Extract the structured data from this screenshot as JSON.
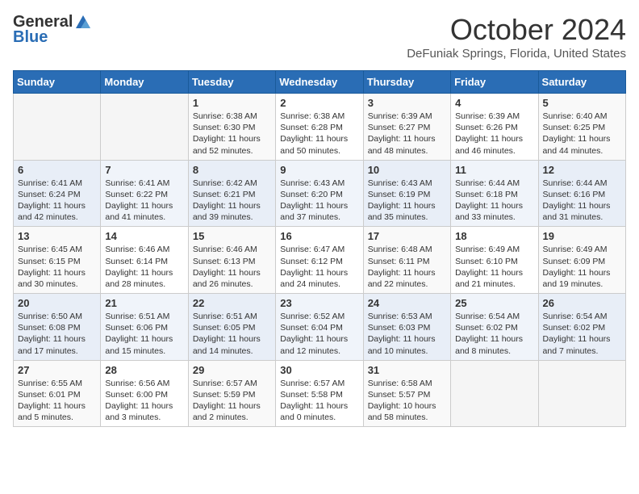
{
  "header": {
    "logo_general": "General",
    "logo_blue": "Blue",
    "month": "October 2024",
    "location": "DeFuniak Springs, Florida, United States"
  },
  "weekdays": [
    "Sunday",
    "Monday",
    "Tuesday",
    "Wednesday",
    "Thursday",
    "Friday",
    "Saturday"
  ],
  "weeks": [
    [
      {
        "day": "",
        "detail": ""
      },
      {
        "day": "",
        "detail": ""
      },
      {
        "day": "1",
        "detail": "Sunrise: 6:38 AM\nSunset: 6:30 PM\nDaylight: 11 hours\nand 52 minutes."
      },
      {
        "day": "2",
        "detail": "Sunrise: 6:38 AM\nSunset: 6:28 PM\nDaylight: 11 hours\nand 50 minutes."
      },
      {
        "day": "3",
        "detail": "Sunrise: 6:39 AM\nSunset: 6:27 PM\nDaylight: 11 hours\nand 48 minutes."
      },
      {
        "day": "4",
        "detail": "Sunrise: 6:39 AM\nSunset: 6:26 PM\nDaylight: 11 hours\nand 46 minutes."
      },
      {
        "day": "5",
        "detail": "Sunrise: 6:40 AM\nSunset: 6:25 PM\nDaylight: 11 hours\nand 44 minutes."
      }
    ],
    [
      {
        "day": "6",
        "detail": "Sunrise: 6:41 AM\nSunset: 6:24 PM\nDaylight: 11 hours\nand 42 minutes."
      },
      {
        "day": "7",
        "detail": "Sunrise: 6:41 AM\nSunset: 6:22 PM\nDaylight: 11 hours\nand 41 minutes."
      },
      {
        "day": "8",
        "detail": "Sunrise: 6:42 AM\nSunset: 6:21 PM\nDaylight: 11 hours\nand 39 minutes."
      },
      {
        "day": "9",
        "detail": "Sunrise: 6:43 AM\nSunset: 6:20 PM\nDaylight: 11 hours\nand 37 minutes."
      },
      {
        "day": "10",
        "detail": "Sunrise: 6:43 AM\nSunset: 6:19 PM\nDaylight: 11 hours\nand 35 minutes."
      },
      {
        "day": "11",
        "detail": "Sunrise: 6:44 AM\nSunset: 6:18 PM\nDaylight: 11 hours\nand 33 minutes."
      },
      {
        "day": "12",
        "detail": "Sunrise: 6:44 AM\nSunset: 6:16 PM\nDaylight: 11 hours\nand 31 minutes."
      }
    ],
    [
      {
        "day": "13",
        "detail": "Sunrise: 6:45 AM\nSunset: 6:15 PM\nDaylight: 11 hours\nand 30 minutes."
      },
      {
        "day": "14",
        "detail": "Sunrise: 6:46 AM\nSunset: 6:14 PM\nDaylight: 11 hours\nand 28 minutes."
      },
      {
        "day": "15",
        "detail": "Sunrise: 6:46 AM\nSunset: 6:13 PM\nDaylight: 11 hours\nand 26 minutes."
      },
      {
        "day": "16",
        "detail": "Sunrise: 6:47 AM\nSunset: 6:12 PM\nDaylight: 11 hours\nand 24 minutes."
      },
      {
        "day": "17",
        "detail": "Sunrise: 6:48 AM\nSunset: 6:11 PM\nDaylight: 11 hours\nand 22 minutes."
      },
      {
        "day": "18",
        "detail": "Sunrise: 6:49 AM\nSunset: 6:10 PM\nDaylight: 11 hours\nand 21 minutes."
      },
      {
        "day": "19",
        "detail": "Sunrise: 6:49 AM\nSunset: 6:09 PM\nDaylight: 11 hours\nand 19 minutes."
      }
    ],
    [
      {
        "day": "20",
        "detail": "Sunrise: 6:50 AM\nSunset: 6:08 PM\nDaylight: 11 hours\nand 17 minutes."
      },
      {
        "day": "21",
        "detail": "Sunrise: 6:51 AM\nSunset: 6:06 PM\nDaylight: 11 hours\nand 15 minutes."
      },
      {
        "day": "22",
        "detail": "Sunrise: 6:51 AM\nSunset: 6:05 PM\nDaylight: 11 hours\nand 14 minutes."
      },
      {
        "day": "23",
        "detail": "Sunrise: 6:52 AM\nSunset: 6:04 PM\nDaylight: 11 hours\nand 12 minutes."
      },
      {
        "day": "24",
        "detail": "Sunrise: 6:53 AM\nSunset: 6:03 PM\nDaylight: 11 hours\nand 10 minutes."
      },
      {
        "day": "25",
        "detail": "Sunrise: 6:54 AM\nSunset: 6:02 PM\nDaylight: 11 hours\nand 8 minutes."
      },
      {
        "day": "26",
        "detail": "Sunrise: 6:54 AM\nSunset: 6:02 PM\nDaylight: 11 hours\nand 7 minutes."
      }
    ],
    [
      {
        "day": "27",
        "detail": "Sunrise: 6:55 AM\nSunset: 6:01 PM\nDaylight: 11 hours\nand 5 minutes."
      },
      {
        "day": "28",
        "detail": "Sunrise: 6:56 AM\nSunset: 6:00 PM\nDaylight: 11 hours\nand 3 minutes."
      },
      {
        "day": "29",
        "detail": "Sunrise: 6:57 AM\nSunset: 5:59 PM\nDaylight: 11 hours\nand 2 minutes."
      },
      {
        "day": "30",
        "detail": "Sunrise: 6:57 AM\nSunset: 5:58 PM\nDaylight: 11 hours\nand 0 minutes."
      },
      {
        "day": "31",
        "detail": "Sunrise: 6:58 AM\nSunset: 5:57 PM\nDaylight: 10 hours\nand 58 minutes."
      },
      {
        "day": "",
        "detail": ""
      },
      {
        "day": "",
        "detail": ""
      }
    ]
  ]
}
